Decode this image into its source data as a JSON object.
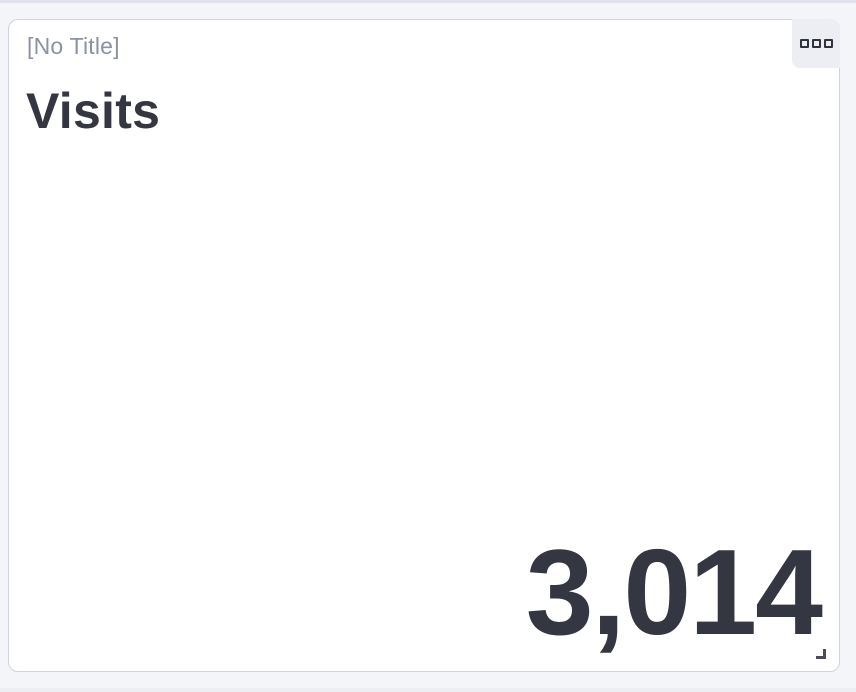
{
  "panel": {
    "title": "[No Title]",
    "label": "Visits",
    "value": "3,014",
    "menu_icon": "more-options-icon",
    "resize_icon": "resize-handle-icon"
  },
  "colors": {
    "text_primary": "#343641",
    "text_muted": "#8b92a3",
    "menu_bg": "#eceef3",
    "border": "#cfd3dc"
  }
}
